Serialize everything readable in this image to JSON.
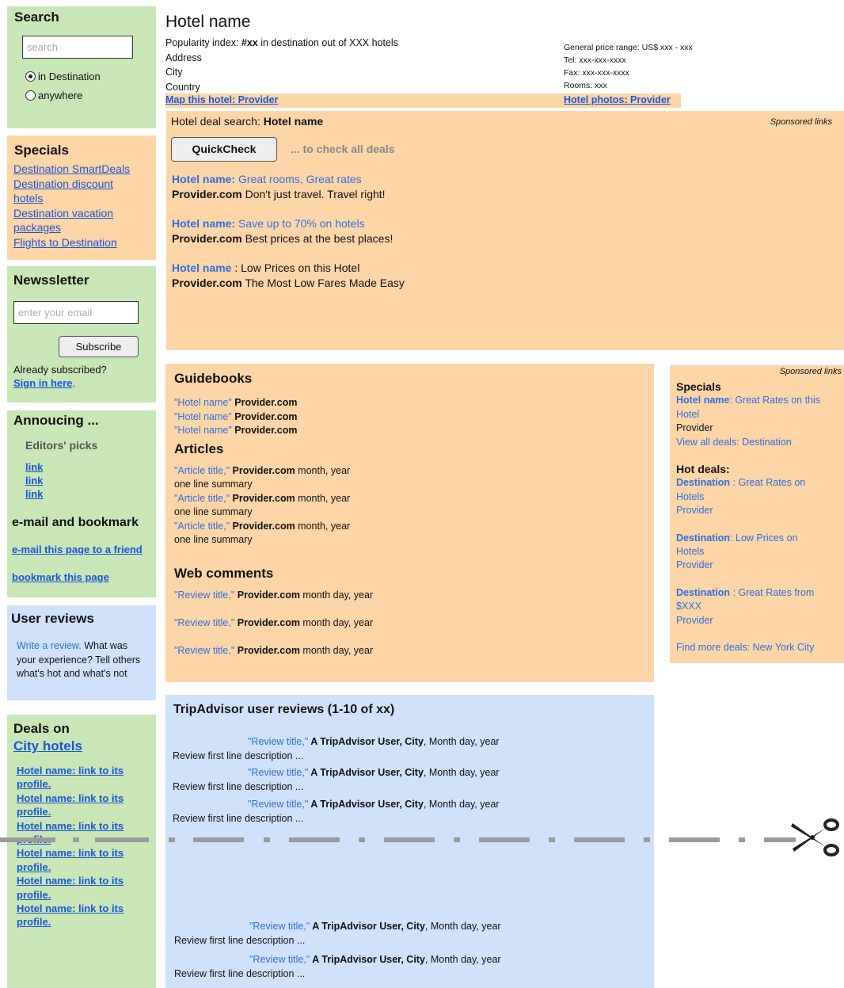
{
  "search": {
    "title": "Search",
    "placeholder": "search",
    "opt1": "in Destination",
    "opt2": "anywhere"
  },
  "specials_left": {
    "title": "Specials",
    "links": [
      "Destination SmartDeals ",
      "Destination discount",
      "hotels ",
      "Destination vacation",
      "packages",
      "Flights to Destination"
    ]
  },
  "newsletter": {
    "title": "Newssletter",
    "placeholder": "enter your email",
    "button": "Subscribe",
    "already": "Already subscribed?",
    "signin": "Sign in here",
    "dot": "."
  },
  "announcing": {
    "title": "Annoucing ...",
    "picks": "Editors' picks",
    "links": [
      "link ",
      "link ",
      "link"
    ],
    "email_title": "e-mail and bookmark",
    "email_link": "e-mail this page to a friend",
    "bookmark_link": "bookmark this page"
  },
  "user_reviews": {
    "title": "User reviews",
    "write": "Write a review.",
    "rest1": " What was",
    "rest2": "your experience? Tell others",
    "rest3": "what's hot and what's not"
  },
  "deals": {
    "title1": "Deals on",
    "title2": "City hotels",
    "links": [
      "Hotel name: link to its",
      "profile.",
      "Hotel name: link to its",
      "profile.",
      "Hotel name: link to its",
      "profile.",
      "Hotel name: link to its",
      "profile.",
      "Hotel name: link to its",
      "profile.",
      "Hotel name: link to its",
      "profile."
    ]
  },
  "hotel": {
    "name": "Hotel name",
    "pop1": "Popularity index: ",
    "pop_b": "#xx",
    "pop2": " in destination out of XXX hotels",
    "address": "Address",
    "city": "City",
    "country": "Country",
    "map_link": "Map this hotel: Provider",
    "price": "General price range: US$ xxx - xxx",
    "tel": "Tel: xxx-xxx-xxxx",
    "fax": "Fax: xxx-xxx-xxxx",
    "rooms": "Rooms: xxx",
    "photos_link": "Hotel photos: Provider"
  },
  "dealsearch": {
    "label": "Hotel deal search: ",
    "name": "Hotel name",
    "sponsored": "Sponsored links",
    "button": "QuickCheck",
    "check": "... to check all deals",
    "ads": [
      {
        "a": "Hotel name:",
        "b": "  Great rooms, Great rates",
        "c": "Provider.com",
        "d": " Don't just travel. Travel right!"
      },
      {
        "a": "Hotel name:",
        "b": " Save up to 70% on hotels",
        "c": "Provider.com",
        "d": " Best prices at the best places!"
      },
      {
        "a": "Hotel name",
        "b": " : Low Prices on this Hotel",
        "c": "Provider.com",
        "d": " The Most Low Fares Made Easy"
      }
    ]
  },
  "guide": {
    "title": "Guidebooks",
    "hn": "\"Hotel name\"",
    "prov": " Provider.com",
    "articles_title": "Articles",
    "article_title": "\"Article title,\"",
    "article_prov": " Provider.com",
    "article_date": " month, year",
    "summary": "one line summary",
    "web_title": "Web comments",
    "review_title": "\"Review title,\"",
    "review_date": " month day, year"
  },
  "right": {
    "sponsored": "Sponsored links",
    "specials": "Specials",
    "hn": "Hotel name",
    "hn_rest": ": Great Rates on this",
    "hn_rest2": "Hotel",
    "provider": "Provider",
    "view_all": "View all deals: Destination",
    "hot": "Hot deals:",
    "d1a": "Destination",
    "d1b": " : Great Rates on",
    "d1c": "Hotels",
    "d2a": "Destination",
    "d2b": ": Low Prices on",
    "d2c": "Hotels",
    "d3a": "Destination",
    "d3b": "  : Great Rates from",
    "d3c": "$XXX",
    "find": "Find more deals: New York City"
  },
  "ta": {
    "title": "TripAdvisor user reviews (1-10 of xx)",
    "review_title": "\"Review title,\"",
    "user": " A TripAdvisor User, City",
    "date": ", Month day, year",
    "desc": "Review first line description ..."
  }
}
